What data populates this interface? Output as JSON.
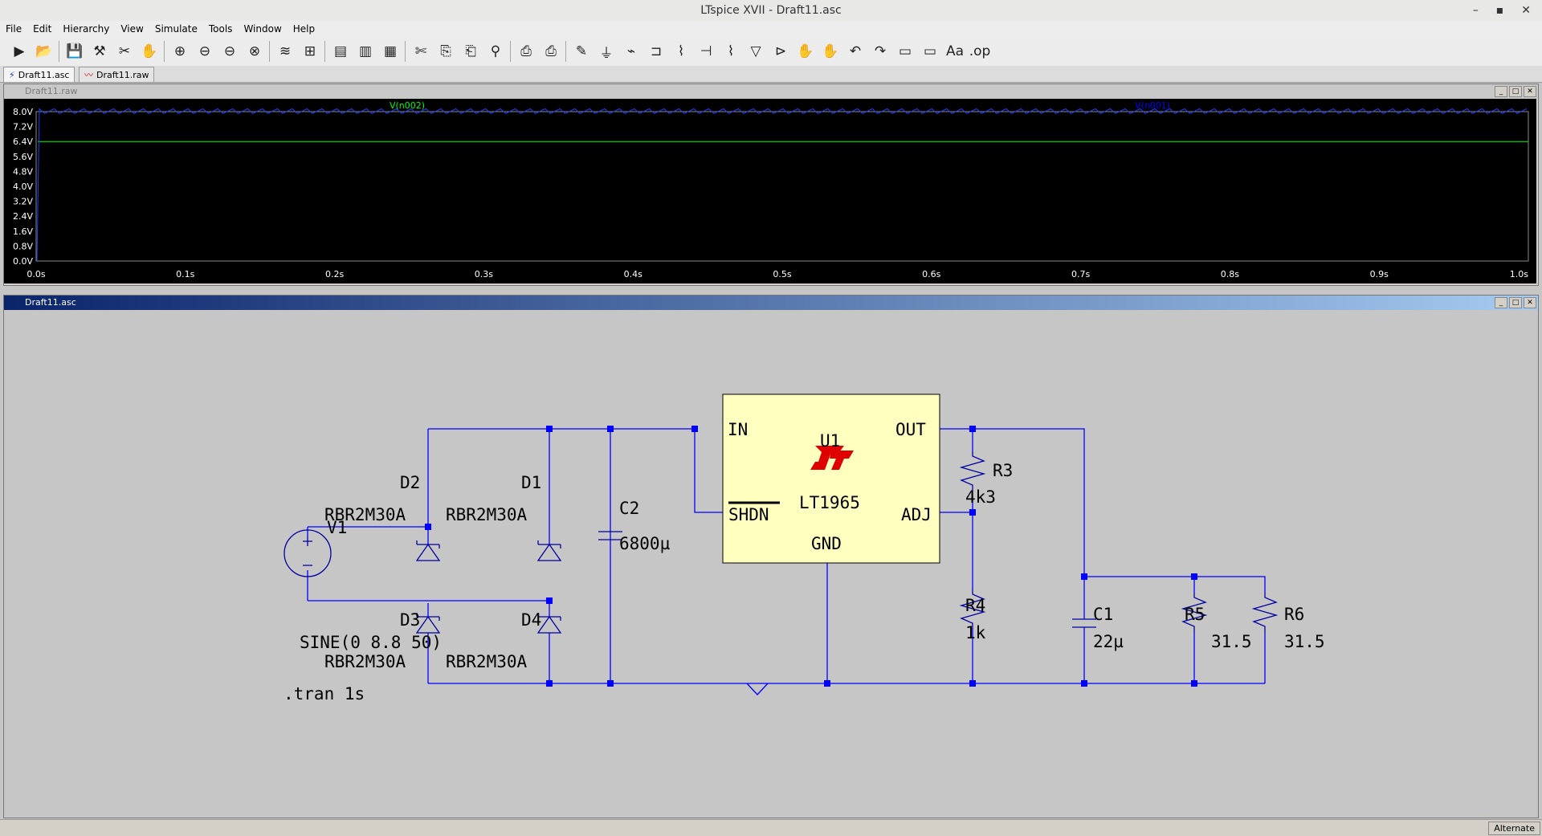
{
  "app": {
    "title": "LTspice XVII - Draft11.asc"
  },
  "window_controls": [
    "–",
    "▪",
    "✕"
  ],
  "menu": [
    "File",
    "Edit",
    "Hierarchy",
    "View",
    "Simulate",
    "Tools",
    "Window",
    "Help"
  ],
  "toolbar": {
    "glyphs": [
      "▶",
      "📂",
      "💾",
      "⚒",
      "✂",
      "✋",
      "⊕",
      "⊖",
      "⊖",
      "⊗",
      "≋",
      "⊞",
      "▤",
      "▥",
      "▦",
      "✄",
      "⎘",
      "⎗",
      "⚲",
      "⎙",
      "⎙",
      "✎",
      "⏚",
      "⌁",
      "⊐",
      "⌇",
      "⊣",
      "⌇",
      "▽",
      "⊳",
      "✋",
      "✋",
      "↶",
      "↷",
      "▭",
      "▭",
      "Aa",
      ".op"
    ]
  },
  "tabs": [
    {
      "label": "Draft11.asc",
      "icon": "schematic-icon"
    },
    {
      "label": "Draft11.raw",
      "icon": "waveform-icon"
    }
  ],
  "waveform": {
    "title": "Draft11.raw",
    "traces": [
      {
        "name": "V(n002)",
        "color": "#00ff00",
        "level": 6.4
      },
      {
        "name": "V(n001)",
        "color": "#0000ff",
        "ripple": [
          7.9,
          8.15
        ]
      }
    ],
    "y_ticks": [
      "8.0V",
      "7.2V",
      "6.4V",
      "5.6V",
      "4.8V",
      "4.0V",
      "3.2V",
      "2.4V",
      "1.6V",
      "0.8V",
      "0.0V"
    ],
    "x_ticks": [
      "0.0s",
      "0.1s",
      "0.2s",
      "0.3s",
      "0.4s",
      "0.5s",
      "0.6s",
      "0.7s",
      "0.8s",
      "0.9s",
      "1.0s"
    ],
    "y_range": [
      0,
      8.0
    ],
    "x_range": [
      0,
      1.0
    ]
  },
  "schematic": {
    "title": "Draft11.asc",
    "components": {
      "d1": {
        "ref": "D1",
        "value": "RBR2M30A"
      },
      "d2": {
        "ref": "D2",
        "value": "RBR2M30A"
      },
      "d3": {
        "ref": "D3",
        "value": "RBR2M30A"
      },
      "d4": {
        "ref": "D4",
        "value": "RBR2M30A"
      },
      "v1": {
        "ref": "V1",
        "value": "SINE(0 8.8 50)"
      },
      "c2": {
        "ref": "C2",
        "value": "6800µ"
      },
      "c1": {
        "ref": "C1",
        "value": "22µ"
      },
      "r3": {
        "ref": "R3",
        "value": "4k3"
      },
      "r4": {
        "ref": "R4",
        "value": "1k"
      },
      "r5": {
        "ref": "R5",
        "value": "31.5"
      },
      "r6": {
        "ref": "R6",
        "value": "31.5"
      },
      "u1": {
        "ref": "U1",
        "part": "LT1965",
        "pins": {
          "in": "IN",
          "out": "OUT",
          "shdn": "SHDN",
          "adj": "ADJ",
          "gnd": "GND"
        }
      }
    },
    "directive": ".tran 1s",
    "colors": {
      "wire": "#0000ff",
      "component": "#0000a0",
      "ic_fill": "#ffffc0",
      "logo": "#e00000"
    }
  },
  "status": {
    "mode": "Alternate"
  }
}
